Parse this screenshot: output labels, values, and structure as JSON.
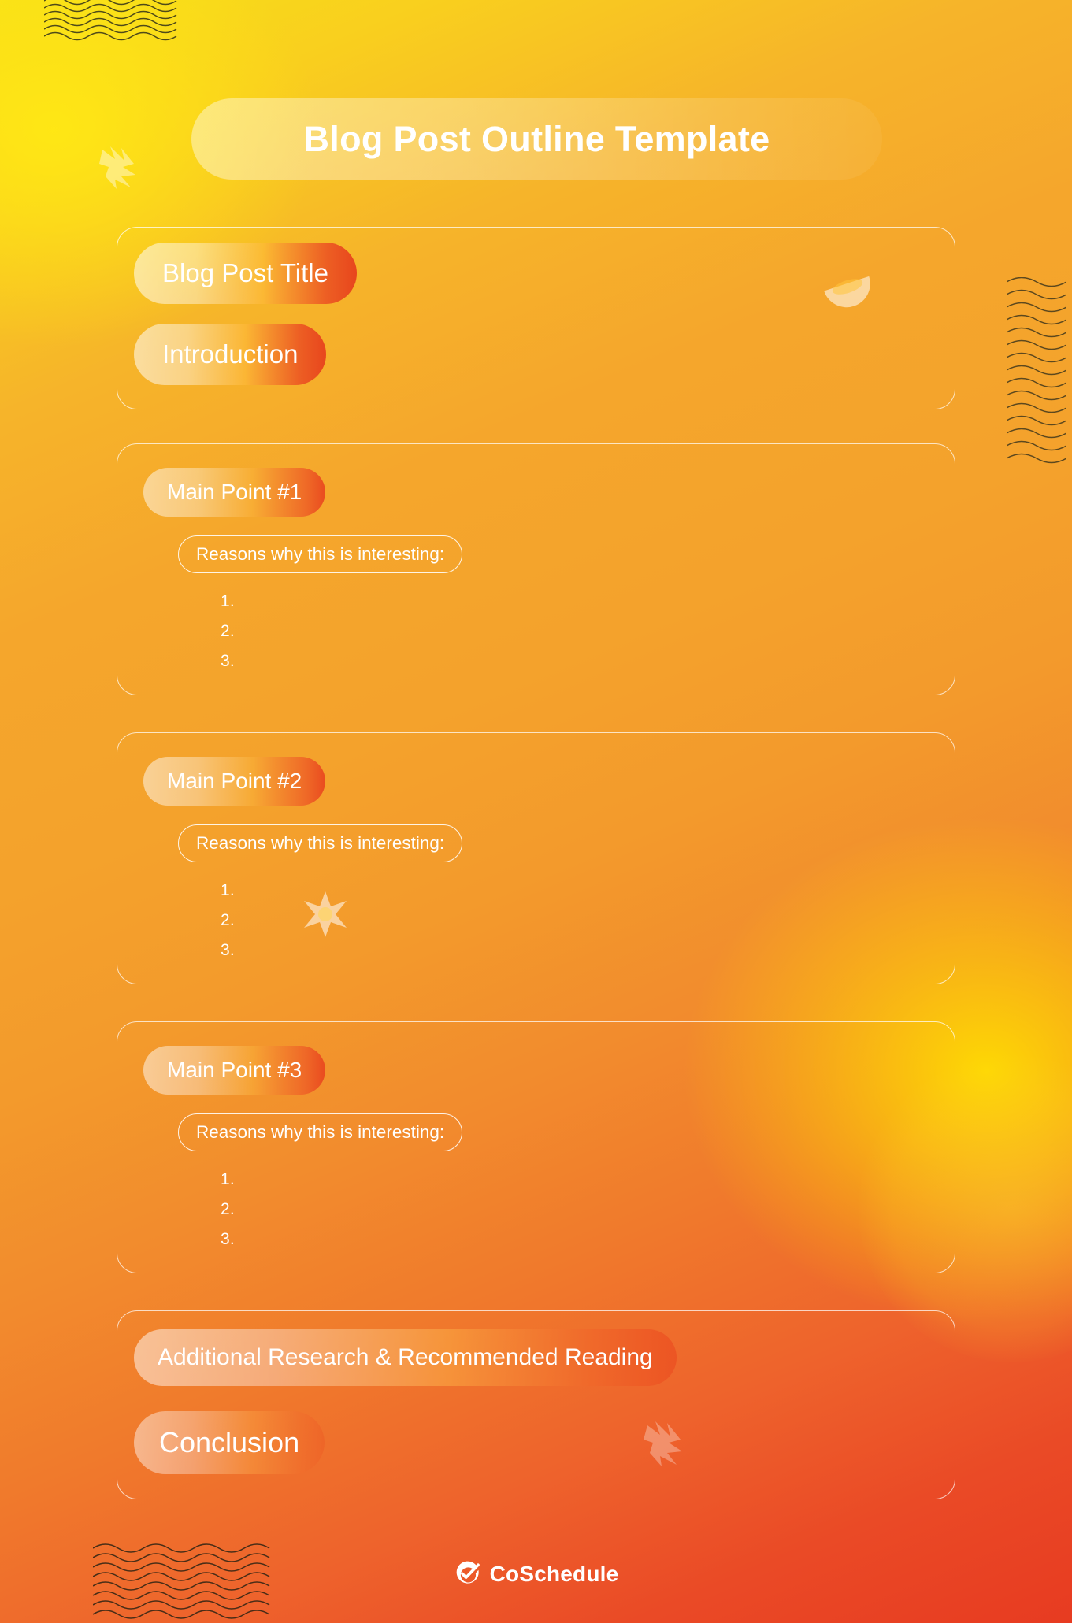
{
  "poster": {
    "title": "Blog Post Outline Template",
    "background_colors": {
      "top_left": "#f7e018",
      "mid": "#f4a22c",
      "bottom": "#e73b21",
      "accent_right_glow": "#ffe13c"
    }
  },
  "sections": [
    {
      "id": "intro-card",
      "pills": [
        {
          "label": "Blog Post Title",
          "style": "large"
        },
        {
          "label": "Introduction",
          "style": "large"
        }
      ]
    },
    {
      "id": "main-point-1",
      "heading": "Main Point #1",
      "subheading": "Reasons why this is interesting:",
      "items": [
        "1.",
        "2.",
        "3."
      ]
    },
    {
      "id": "main-point-2",
      "heading": "Main Point #2",
      "subheading": "Reasons why this is interesting:",
      "items": [
        "1.",
        "2.",
        "3."
      ]
    },
    {
      "id": "main-point-3",
      "heading": "Main Point #3",
      "subheading": "Reasons why this is interesting:",
      "items": [
        "1.",
        "2.",
        "3."
      ]
    },
    {
      "id": "closing-card",
      "pills": [
        {
          "label": "Additional Research & Recommended Reading",
          "style": "medium"
        },
        {
          "label": "Conclusion",
          "style": "large"
        }
      ]
    }
  ],
  "footer": {
    "brand": "CoSchedule",
    "logo_icon": "check-circle-icon"
  },
  "decorations": [
    {
      "name": "wave-lines-top-left"
    },
    {
      "name": "wave-lines-right"
    },
    {
      "name": "wave-lines-bottom-left"
    },
    {
      "name": "lemon-slice"
    },
    {
      "name": "six-point-sparkle"
    },
    {
      "name": "zigzag-burst-top-left"
    },
    {
      "name": "zigzag-burst-bottom"
    },
    {
      "name": "radial-glow-circle"
    }
  ]
}
